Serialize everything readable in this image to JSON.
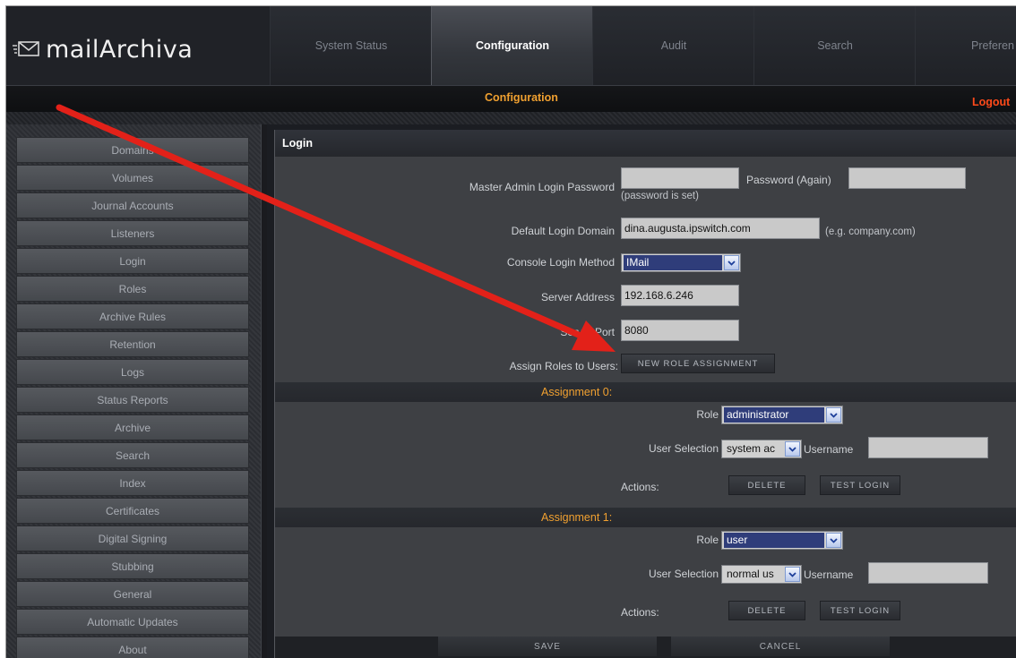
{
  "app": {
    "logo_text": "mailArchiva"
  },
  "nav": {
    "tabs": [
      {
        "label": "System Status"
      },
      {
        "label": "Configuration",
        "active": true
      },
      {
        "label": "Audit"
      },
      {
        "label": "Search"
      },
      {
        "label": "Preferen"
      }
    ]
  },
  "subbar": {
    "breadcrumb": "Configuration",
    "logout": "Logout"
  },
  "sidebar": {
    "items": [
      {
        "label": "Domains"
      },
      {
        "label": "Volumes"
      },
      {
        "label": "Journal Accounts"
      },
      {
        "label": "Listeners"
      },
      {
        "label": "Login"
      },
      {
        "label": "Roles"
      },
      {
        "label": "Archive Rules"
      },
      {
        "label": "Retention"
      },
      {
        "label": "Logs"
      },
      {
        "label": "Status Reports"
      },
      {
        "label": "Archive"
      },
      {
        "label": "Search"
      },
      {
        "label": "Index"
      },
      {
        "label": "Certificates"
      },
      {
        "label": "Digital Signing"
      },
      {
        "label": "Stubbing"
      },
      {
        "label": "General"
      },
      {
        "label": "Automatic Updates"
      },
      {
        "label": "About"
      }
    ]
  },
  "section": {
    "title": "Login"
  },
  "form": {
    "master_password_label": "Master Admin Login Password",
    "password_again_label": "Password (Again)",
    "password_hint": "(password is set)",
    "default_domain_label": "Default Login Domain",
    "default_domain_value": "dina.augusta.ipswitch.com",
    "default_domain_hint": "(e.g. company.com)",
    "console_method_label": "Console Login Method",
    "console_method_value": "IMail",
    "server_address_label": "Server Address",
    "server_address_value": "192.168.6.246",
    "server_port_label": "Server Port",
    "server_port_value": "8080",
    "assign_roles_label": "Assign Roles to Users:",
    "new_role_button": "NEW ROLE ASSIGNMENT"
  },
  "assignments": [
    {
      "header": "Assignment 0:",
      "role_label": "Role",
      "role_value": "administrator",
      "user_selection_label": "User Selection",
      "user_selection_value": "system ac",
      "username_label": "Username",
      "username_value": "",
      "actions_label": "Actions:",
      "delete_button": "DELETE",
      "test_login_button": "TEST LOGIN"
    },
    {
      "header": "Assignment 1:",
      "role_label": "Role",
      "role_value": "user",
      "user_selection_label": "User Selection",
      "user_selection_value": "normal us",
      "username_label": "Username",
      "username_value": "",
      "actions_label": "Actions:",
      "delete_button": "DELETE",
      "test_login_button": "TEST LOGIN"
    }
  ],
  "footer": {
    "save_button": "SAVE",
    "cancel_button": "CANCEL"
  },
  "colors": {
    "accent": "#f0a030",
    "logout": "#ff4a1a",
    "annotation_arrow": "#e32119"
  },
  "icons": {
    "logo": "envelope-icon",
    "dropdown": "chevron-down-icon"
  }
}
